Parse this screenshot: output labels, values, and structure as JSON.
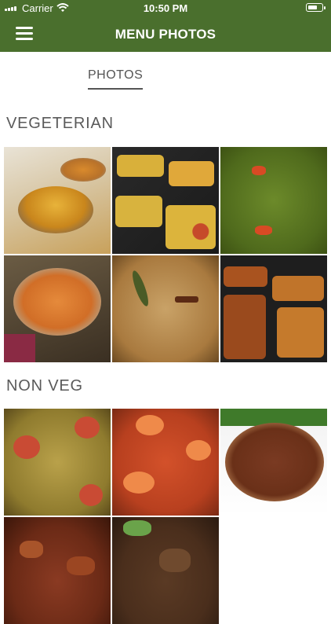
{
  "status_bar": {
    "carrier": "Carrier",
    "time": "10:50 PM"
  },
  "nav": {
    "title": "MENU PHOTOS",
    "menu_icon": "hamburger-menu-icon"
  },
  "tabs": [
    {
      "label": "PHOTOS",
      "selected": true
    }
  ],
  "sections": [
    {
      "title": "VEGETERIAN",
      "photos": [
        {
          "subject": "dal-bowl"
        },
        {
          "subject": "curry-trays"
        },
        {
          "subject": "green-saag"
        },
        {
          "subject": "paneer-curry-pot"
        },
        {
          "subject": "rice-pilaf"
        },
        {
          "subject": "curry-trays-2"
        }
      ]
    },
    {
      "title": "NON VEG",
      "photos": [
        {
          "subject": "fish-curry"
        },
        {
          "subject": "shrimp-curry"
        },
        {
          "subject": "chicken-curry"
        },
        {
          "subject": "fried-meat"
        },
        {
          "subject": "lamb-curry"
        }
      ]
    }
  ],
  "colors": {
    "nav_background": "#4a6f2d",
    "nav_text": "#ffffff",
    "section_text": "#5a5a5a"
  }
}
